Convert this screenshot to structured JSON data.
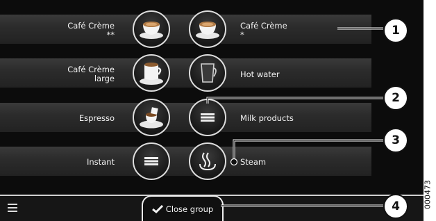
{
  "beverages_left": [
    {
      "name": "Café Crème",
      "sub": "**",
      "icon": "cup-saucer-icon"
    },
    {
      "name": "Café Crème",
      "sub": "large",
      "icon": "large-cup-saucer-icon"
    },
    {
      "name": "Espresso",
      "sub": "",
      "icon": "espresso-cup-icon"
    },
    {
      "name": "Instant",
      "sub": "",
      "icon": "group-menu-icon"
    }
  ],
  "beverages_right": [
    {
      "name": "Café Crème",
      "sub": "*",
      "icon": "cup-saucer-icon"
    },
    {
      "name": "Hot water",
      "sub": "",
      "icon": "glass-mug-icon"
    },
    {
      "name": "Milk products",
      "sub": "",
      "icon": "group-menu-icon"
    },
    {
      "name": "Steam",
      "sub": "",
      "icon": "steam-icon"
    }
  ],
  "footer": {
    "close_group_label": "Close group",
    "menu_icon": "hamburger-menu-icon",
    "check_icon": "checkmark-icon"
  },
  "callouts": [
    "1",
    "2",
    "3",
    "4"
  ],
  "image_code": "000473",
  "colors": {
    "screen_bg": "#0c0c0c",
    "band": "#2e2e2e",
    "text": "#f2f2f2",
    "callout_border": "#111111"
  }
}
